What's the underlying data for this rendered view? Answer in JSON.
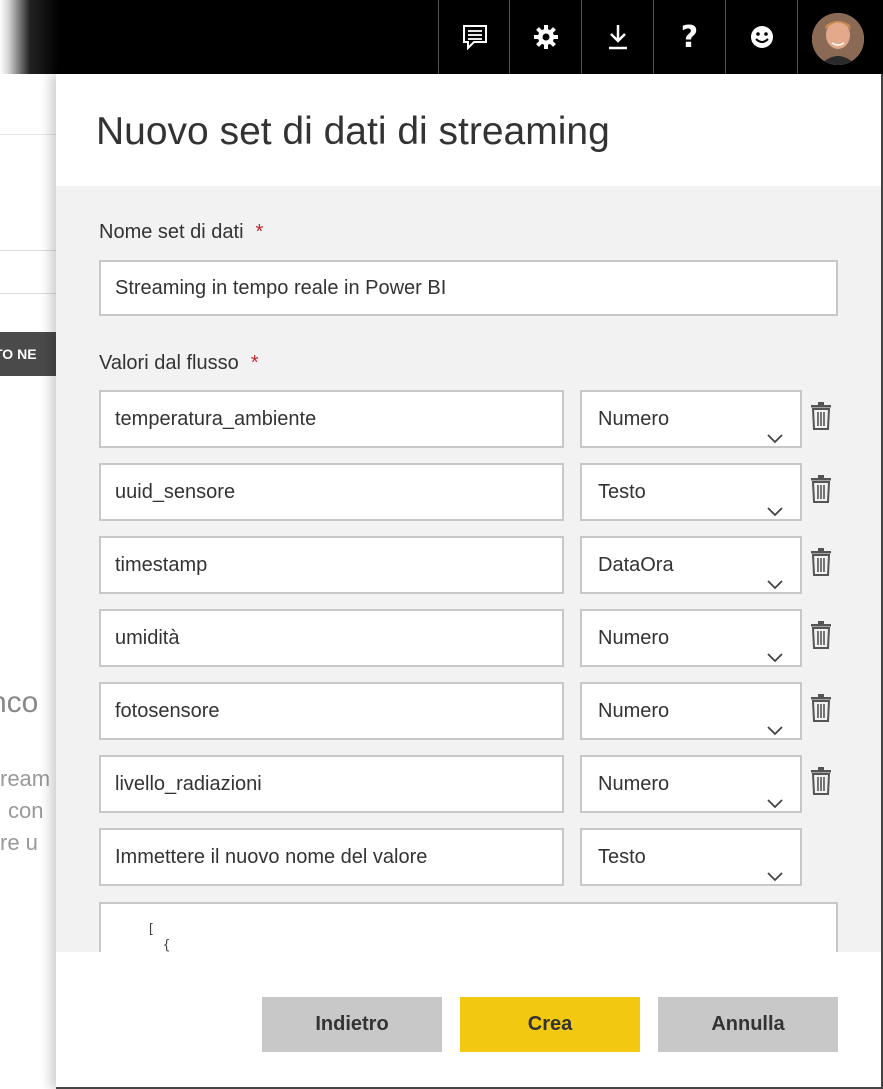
{
  "topbar": {
    "buttons": [
      {
        "icon": "feedback-icon"
      },
      {
        "icon": "gear-icon"
      },
      {
        "icon": "download-icon"
      },
      {
        "icon": "help-icon"
      },
      {
        "icon": "smiley-icon"
      }
    ],
    "help_glyph": "?"
  },
  "background": {
    "tab_text": "TO NE",
    "partial_heading": "nco",
    "partial_lines": [
      "ream",
      "con",
      "re u"
    ]
  },
  "panel": {
    "title": "Nuovo set di dati di streaming",
    "dataset_name_label": "Nome set di dati",
    "required_mark": "*",
    "dataset_name_value": "Streaming in tempo reale in Power BI",
    "values_label": "Valori dal flusso",
    "rows": [
      {
        "name": "temperatura_ambiente",
        "type": "Numero"
      },
      {
        "name": "uuid_sensore",
        "type": "Testo"
      },
      {
        "name": "timestamp",
        "type": "DataOra"
      },
      {
        "name": "umidità",
        "type": "Numero"
      },
      {
        "name": "fotosensore",
        "type": "Numero"
      },
      {
        "name": "livello_radiazioni",
        "type": "Numero"
      }
    ],
    "new_value_placeholder": "Immettere il nuovo nome del valore",
    "new_value_type": "Testo",
    "json_preview": "[\n  {"
  },
  "footer": {
    "back_label": "Indietro",
    "create_label": "Crea",
    "cancel_label": "Annulla"
  },
  "colors": {
    "accent_yellow": "#F2C811",
    "required_red": "#C4262E",
    "topbar_black": "#000000"
  }
}
